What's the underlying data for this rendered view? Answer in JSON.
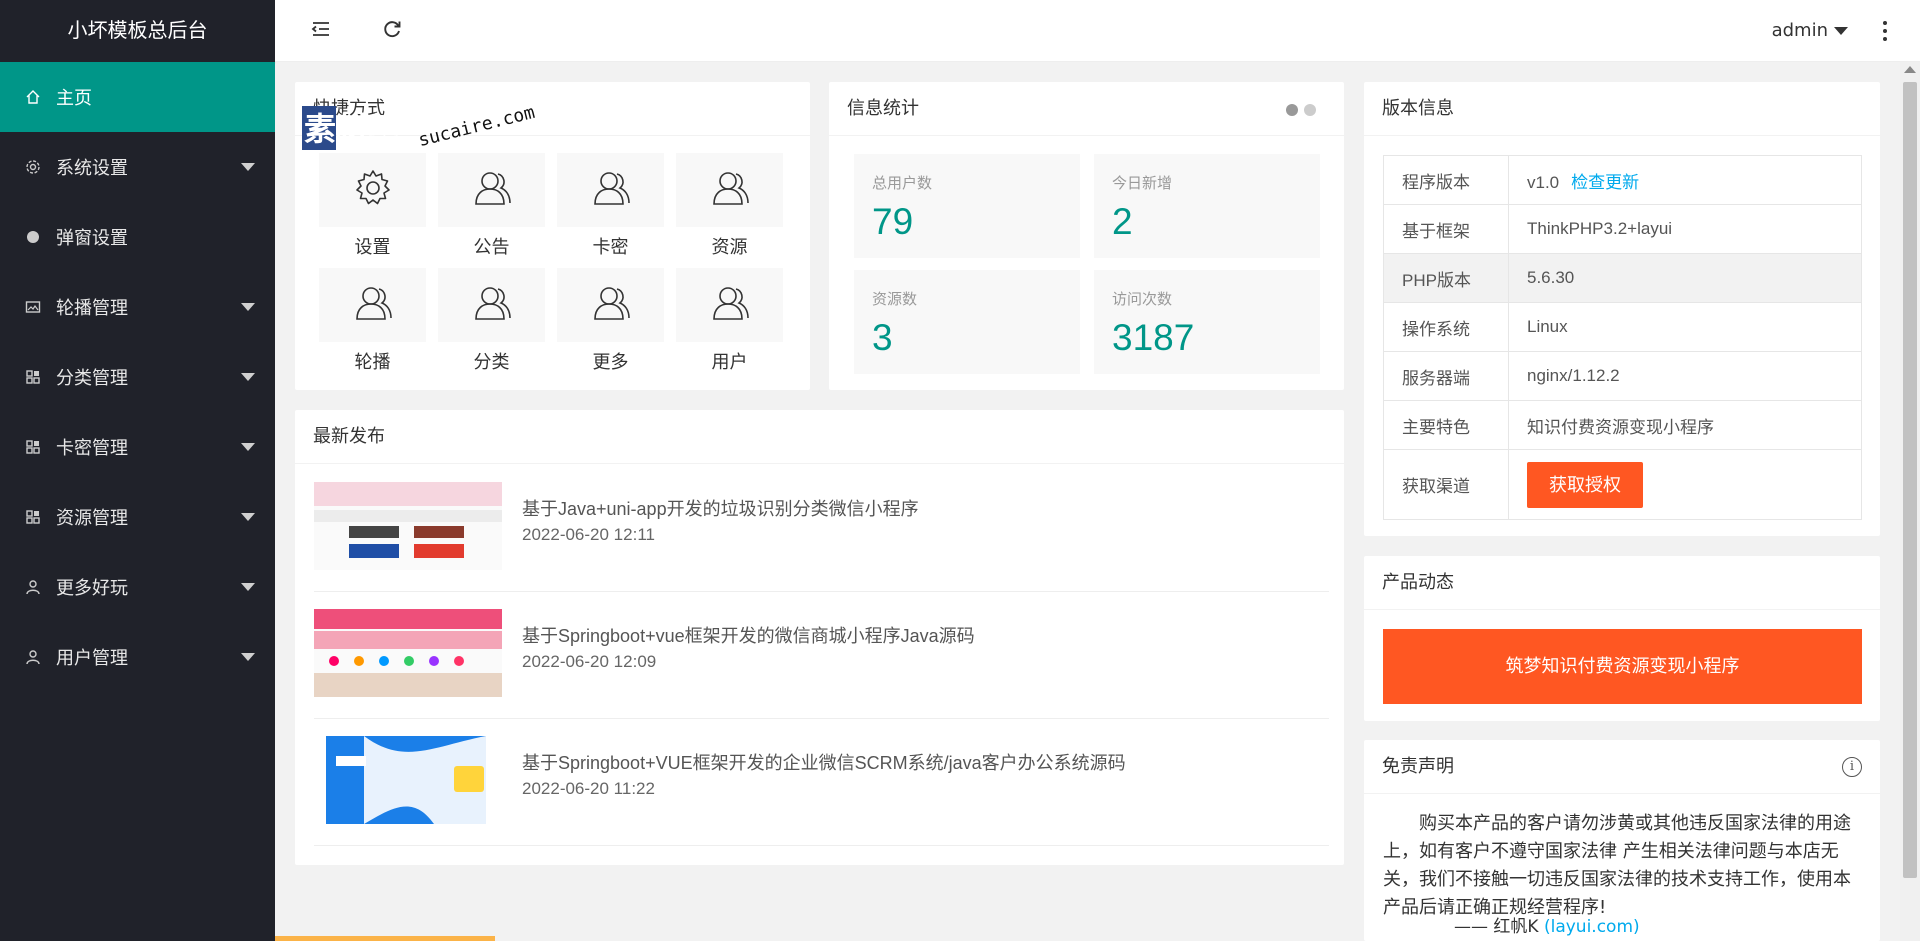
{
  "app": {
    "title": "小坏模板总后台"
  },
  "sidebar": {
    "items": [
      {
        "label": "主页",
        "icon": "home-icon",
        "active": true,
        "has_caret": false
      },
      {
        "label": "系统设置",
        "icon": "gear-icon",
        "has_caret": true
      },
      {
        "label": "弹窗设置",
        "icon": "circle-icon",
        "has_caret": false
      },
      {
        "label": "轮播管理",
        "icon": "image-icon",
        "has_caret": true
      },
      {
        "label": "分类管理",
        "icon": "grid-icon",
        "has_caret": true
      },
      {
        "label": "卡密管理",
        "icon": "grid-icon",
        "has_caret": true
      },
      {
        "label": "资源管理",
        "icon": "grid-icon",
        "has_caret": true
      },
      {
        "label": "更多好玩",
        "icon": "user-icon",
        "has_caret": true
      },
      {
        "label": "用户管理",
        "icon": "user-icon",
        "has_caret": true
      }
    ]
  },
  "header": {
    "user": "admin"
  },
  "shortcuts": {
    "title": "快捷方式",
    "items": [
      {
        "label": "设置",
        "icon": "gear-icon"
      },
      {
        "label": "公告",
        "icon": "users-icon"
      },
      {
        "label": "卡密",
        "icon": "users-icon"
      },
      {
        "label": "资源",
        "icon": "users-icon"
      },
      {
        "label": "轮播",
        "icon": "users-icon"
      },
      {
        "label": "分类",
        "icon": "users-icon"
      },
      {
        "label": "更多",
        "icon": "users-icon"
      },
      {
        "label": "用户",
        "icon": "users-icon"
      }
    ]
  },
  "watermark": {
    "brand": "素材熱",
    "domain": "sucaire.com"
  },
  "stats": {
    "title": "信息统计",
    "items": [
      {
        "label": "总用户数",
        "value": "79"
      },
      {
        "label": "今日新增",
        "value": "2"
      },
      {
        "label": "资源数",
        "value": "3"
      },
      {
        "label": "访问次数",
        "value": "3187"
      }
    ]
  },
  "latest": {
    "title": "最新发布",
    "posts": [
      {
        "title": "基于Java+uni-app开发的垃圾识别分类微信小程序",
        "date": "2022-06-20 12:11"
      },
      {
        "title": "基于Springboot+vue框架开发的微信商城小程序Java源码",
        "date": "2022-06-20 12:09"
      },
      {
        "title": "基于Springboot+VUE框架开发的企业微信SCRM系统/java客户办公系统源码",
        "date": "2022-06-20 11:22"
      }
    ]
  },
  "version": {
    "title": "版本信息",
    "rows": [
      {
        "key": "程序版本",
        "value": "v1.0",
        "link": "检查更新"
      },
      {
        "key": "基于框架",
        "value": "ThinkPHP3.2+layui"
      },
      {
        "key": "PHP版本",
        "value": "5.6.30"
      },
      {
        "key": "操作系统",
        "value": "Linux"
      },
      {
        "key": "服务器端",
        "value": "nginx/1.12.2"
      },
      {
        "key": "主要特色",
        "value": "知识付费资源变现小程序"
      },
      {
        "key": "获取渠道",
        "button": "获取授权"
      }
    ]
  },
  "product": {
    "title": "产品动态",
    "banner": "筑梦知识付费资源变现小程序"
  },
  "disclaimer": {
    "title": "免责声明",
    "text": "购买本产品的客户请勿涉黄或其他违反国家法律的用途上，如有客户不遵守国家法律 产生相关法律问题与本店无关，我们不接触一切违反国家法律的技术支持工作，使用本产品后请正确正规经营程序!",
    "author": "—— 红帆K",
    "author_link": "(layui.com)"
  },
  "colors": {
    "sidebar_bg": "#20222a",
    "accent": "#009688",
    "orange": "#ff5722",
    "link": "#01aaed"
  }
}
